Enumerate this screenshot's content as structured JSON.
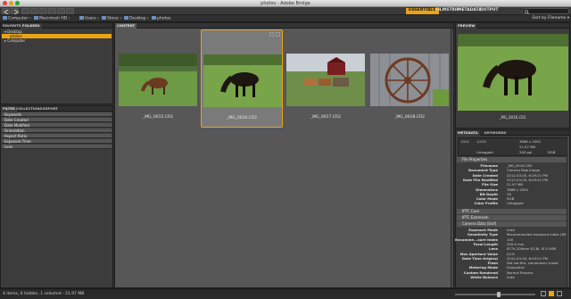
{
  "window": {
    "title": "photos - Adobe Bridge"
  },
  "workspaces": {
    "tabs": [
      "ESSENTIALS",
      "FILMSTRIP",
      "METADATA",
      "OUTPUT"
    ],
    "active": "ESSENTIALS"
  },
  "search": {
    "placeholder": ""
  },
  "path": {
    "crumbs": [
      "Computer",
      "Macintosh HD",
      "Users",
      "Steve",
      "Desktop",
      "photos"
    ]
  },
  "sort": {
    "label": "Sort by Filename"
  },
  "left_panel": {
    "tabs": [
      "FAVORITES",
      "FOLDERS"
    ],
    "active_tab": "FOLDERS",
    "tree": [
      {
        "label": "Desktop",
        "selected": false
      },
      {
        "label": "photos",
        "selected": true
      },
      {
        "label": "Computer",
        "selected": false
      }
    ]
  },
  "filter_panel": {
    "tabs": [
      "FILTER",
      "COLLECTIONS",
      "EXPORT"
    ],
    "active_tab": "FILTER",
    "rows": [
      "Keywords",
      "Date Created",
      "Date Modified",
      "Orientation",
      "Aspect Ratio",
      "Exposure Time",
      "Lens"
    ]
  },
  "content_panel": {
    "tab": "CONTENT"
  },
  "thumbnails": [
    {
      "name": "_MG_0015.CR2",
      "selected": false,
      "scene": "horse-brown"
    },
    {
      "name": "_MG_0016.CR2",
      "selected": true,
      "scene": "horse-black"
    },
    {
      "name": "_MG_0017.CR2",
      "selected": false,
      "scene": "horses-wagon"
    },
    {
      "name": "_MG_0018.CR2",
      "selected": false,
      "scene": "wagon-wheel"
    }
  ],
  "preview_panel": {
    "tab": "PREVIEW",
    "caption": "_MG_0016.CR2"
  },
  "metadata_panel": {
    "tabs": [
      "METADATA",
      "KEYWORDS"
    ],
    "active_tab": "METADATA",
    "summary": {
      "aperture": "f/4.5",
      "shutter": "1/125",
      "dimensions": "3888 x 2592",
      "size": "21.97 MB",
      "ppi": "240 ppi",
      "profile": "Untagged",
      "mode": "RGB"
    },
    "sections": [
      {
        "title": "File Properties",
        "rows": [
          {
            "k": "Filename",
            "v": "_MG_0016.CR2"
          },
          {
            "k": "Document Type",
            "v": "Camera Raw image"
          },
          {
            "k": "Date Created",
            "v": "2012-03-05, 6:29:21 PM"
          },
          {
            "k": "Date File Modified",
            "v": "2012-03-05, 6:29:21 PM"
          },
          {
            "k": "File Size",
            "v": "21.97 MB"
          },
          {
            "k": "Dimensions",
            "v": "3888 x 2592"
          },
          {
            "k": "Bit Depth",
            "v": "16"
          },
          {
            "k": "Color Mode",
            "v": "RGB"
          },
          {
            "k": "Color Profile",
            "v": "Untagged"
          }
        ]
      },
      {
        "title": "IPTC Core",
        "rows": []
      },
      {
        "title": "IPTC Extension",
        "rows": []
      },
      {
        "title": "Camera Data (Exif)",
        "rows": [
          {
            "k": "Exposure Mode",
            "v": "Auto"
          },
          {
            "k": "Sensitivity Type",
            "v": "Recommended exposure index (REI)"
          },
          {
            "k": "Recomme...xure Index",
            "v": "100"
          },
          {
            "k": "Focal Length",
            "v": "200.0 mm"
          },
          {
            "k": "Lens",
            "v": "EF70-200mm f/2.8L IS II USM"
          },
          {
            "k": "Max Aperture Value",
            "v": "f/2.8"
          },
          {
            "k": "Date Time Original",
            "v": "2012-03-05, 6:29:21 PM"
          },
          {
            "k": "Flash",
            "v": "Did not fire, compulsory mode"
          },
          {
            "k": "Metering Mode",
            "v": "Evaluative"
          },
          {
            "k": "Custom Rendered",
            "v": "Normal Process"
          },
          {
            "k": "White Balance",
            "v": "Auto"
          }
        ]
      }
    ]
  },
  "status": {
    "text": "4 items, 0 hidden, 1 selected - 21.97 MB"
  },
  "zoom": {
    "level": 0.55
  },
  "colors": {
    "accent": "#e8a317",
    "panel": "#3c3c3c",
    "content": "#575757"
  }
}
